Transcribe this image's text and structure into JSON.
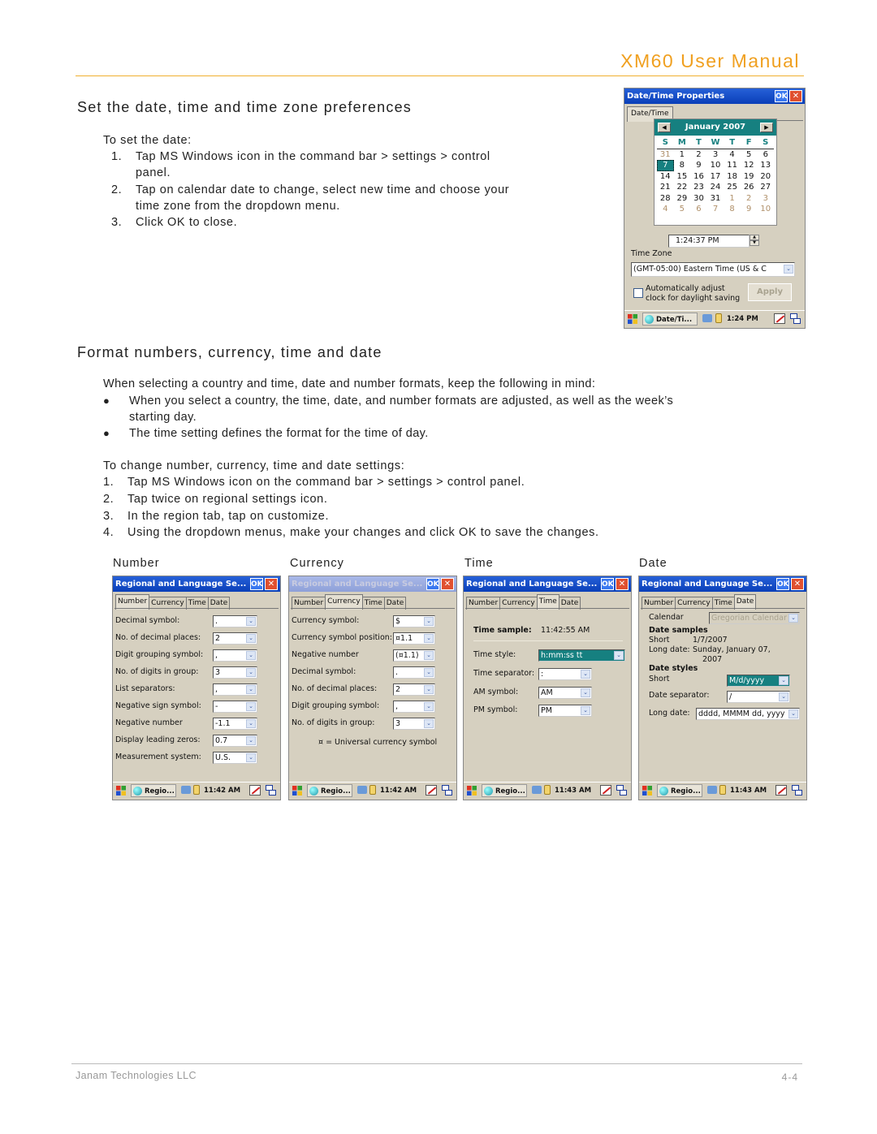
{
  "header": {
    "manual_title": "XM60 User Manual"
  },
  "section1": {
    "heading": "Set the date, time and time zone preferences",
    "intro": "To set the date:",
    "steps": [
      {
        "n": "1.",
        "text": "Tap MS Windows icon in the command bar >  settings >  control",
        "cont": "panel."
      },
      {
        "n": "2.",
        "text": "Tap on calendar date to change, select new time and choose your",
        "cont": "time zone from the dropdown menu."
      },
      {
        "n": "3.",
        "text": "Click OK to close."
      }
    ]
  },
  "datetime_window": {
    "title": "Date/Time Properties",
    "ok": "OK",
    "close": "✕",
    "tab": "Date/Time",
    "month_label": "January  2007",
    "prev": "◀",
    "next": "▶",
    "dow": [
      "S",
      "M",
      "T",
      "W",
      "T",
      "F",
      "S"
    ],
    "weeks": [
      [
        {
          "d": "31",
          "o": true
        },
        {
          "d": "1"
        },
        {
          "d": "2"
        },
        {
          "d": "3"
        },
        {
          "d": "4"
        },
        {
          "d": "5"
        },
        {
          "d": "6"
        }
      ],
      [
        {
          "d": "7",
          "s": true
        },
        {
          "d": "8"
        },
        {
          "d": "9"
        },
        {
          "d": "10"
        },
        {
          "d": "11"
        },
        {
          "d": "12"
        },
        {
          "d": "13"
        }
      ],
      [
        {
          "d": "14"
        },
        {
          "d": "15"
        },
        {
          "d": "16"
        },
        {
          "d": "17"
        },
        {
          "d": "18"
        },
        {
          "d": "19"
        },
        {
          "d": "20"
        }
      ],
      [
        {
          "d": "21"
        },
        {
          "d": "22"
        },
        {
          "d": "23"
        },
        {
          "d": "24"
        },
        {
          "d": "25"
        },
        {
          "d": "26"
        },
        {
          "d": "27"
        }
      ],
      [
        {
          "d": "28"
        },
        {
          "d": "29"
        },
        {
          "d": "30"
        },
        {
          "d": "31"
        },
        {
          "d": "1",
          "o": true
        },
        {
          "d": "2",
          "o": true
        },
        {
          "d": "3",
          "o": true
        }
      ],
      [
        {
          "d": "4",
          "o": true
        },
        {
          "d": "5",
          "o": true
        },
        {
          "d": "6",
          "o": true
        },
        {
          "d": "7",
          "o": true
        },
        {
          "d": "8",
          "o": true
        },
        {
          "d": "9",
          "o": true
        },
        {
          "d": "10",
          "o": true
        }
      ]
    ],
    "time_value": "1:24:37 PM",
    "time_zone_label": "Time Zone",
    "time_zone_value": "(GMT-05:00) Eastern Time (US & C",
    "dst_label_1": "Automatically adjust",
    "dst_label_2": "clock for daylight saving",
    "apply": "Apply",
    "taskbar_app": "Date/Ti...",
    "taskbar_time": "1:24 PM"
  },
  "section2": {
    "heading": "Format numbers, currency, time and date",
    "intro": "When selecting a country and time, date and number formats, keep the following in mind:",
    "bullets": [
      {
        "text": "When you select a country, the time, date, and number formats are adjusted, as well as the week’s",
        "cont": "starting day."
      },
      {
        "text": "The time setting defines the format for the time of day."
      }
    ],
    "steps_intro": "To change number, currency, time and date settings:",
    "steps": [
      {
        "n": "1.",
        "text": "Tap MS Windows icon on the command bar >  settings >  control panel."
      },
      {
        "n": "2.",
        "text": "Tap twice on regional settings icon."
      },
      {
        "n": "3.",
        "text": "In the region tab, tap on customize."
      },
      {
        "n": "4.",
        "text": "Using the dropdown menus, make your changes and click OK to save the changes."
      }
    ],
    "captions": [
      "Number",
      "Currency",
      "Time",
      "Date"
    ]
  },
  "regional": {
    "title": "Regional and Language Se...",
    "ok": "OK",
    "close": "✕",
    "tabs": [
      "Number",
      "Currency",
      "Time",
      "Date"
    ],
    "arrow": "⌄",
    "taskbar_app": "Regio...",
    "number": {
      "rows": [
        {
          "label": "Decimal symbol:",
          "value": "."
        },
        {
          "label": "No. of decimal places:",
          "value": "2"
        },
        {
          "label": "Digit grouping symbol:",
          "value": ","
        },
        {
          "label": "No. of digits in group:",
          "value": "3"
        },
        {
          "label": "List separators:",
          "value": ","
        },
        {
          "label": "Negative sign symbol:",
          "value": "-"
        },
        {
          "label": "Negative number",
          "value": "-1.1"
        },
        {
          "label": "Display leading zeros:",
          "value": "0.7"
        },
        {
          "label": "Measurement system:",
          "value": "U.S."
        }
      ],
      "time": "11:42 AM"
    },
    "currency": {
      "rows": [
        {
          "label": "Currency symbol:",
          "value": "$"
        },
        {
          "label": "Currency symbol position:",
          "value": "¤1.1"
        },
        {
          "label": "Negative number",
          "value": "(¤1.1)"
        },
        {
          "label": "Decimal symbol:",
          "value": "."
        },
        {
          "label": "No. of decimal places:",
          "value": "2"
        },
        {
          "label": "Digit grouping symbol:",
          "value": ","
        },
        {
          "label": "No. of digits in group:",
          "value": "3"
        }
      ],
      "note": "¤ = Universal currency symbol",
      "time": "11:42 AM"
    },
    "time_tab": {
      "sample_label": "Time sample:",
      "sample_value": "11:42:55 AM",
      "rows": [
        {
          "label": "Time style:",
          "value": "h:mm:ss tt"
        },
        {
          "label": "Time separator:",
          "value": ":"
        },
        {
          "label": "AM symbol:",
          "value": "AM"
        },
        {
          "label": "PM symbol:",
          "value": "PM"
        }
      ],
      "time": "11:43 AM"
    },
    "date_tab": {
      "calendar_label": "Calendar",
      "calendar_value": "Gregorian Calendar",
      "samples_heading": "Date samples",
      "short_label": "Short",
      "short_value": "1/7/2007",
      "long_label": "Long date:",
      "long_value_1": "Sunday, January 07,",
      "long_value_2": "2007",
      "styles_heading": "Date styles",
      "short_style_label": "Short",
      "short_style_value": "M/d/yyyy",
      "sep_label": "Date separator:",
      "sep_value": "/",
      "long_style_label": "Long date:",
      "long_style_value": "dddd, MMMM dd, yyyy",
      "time": "11:43 AM"
    }
  },
  "footer": {
    "company": "Janam Technologies LLC",
    "page": "4-4"
  }
}
